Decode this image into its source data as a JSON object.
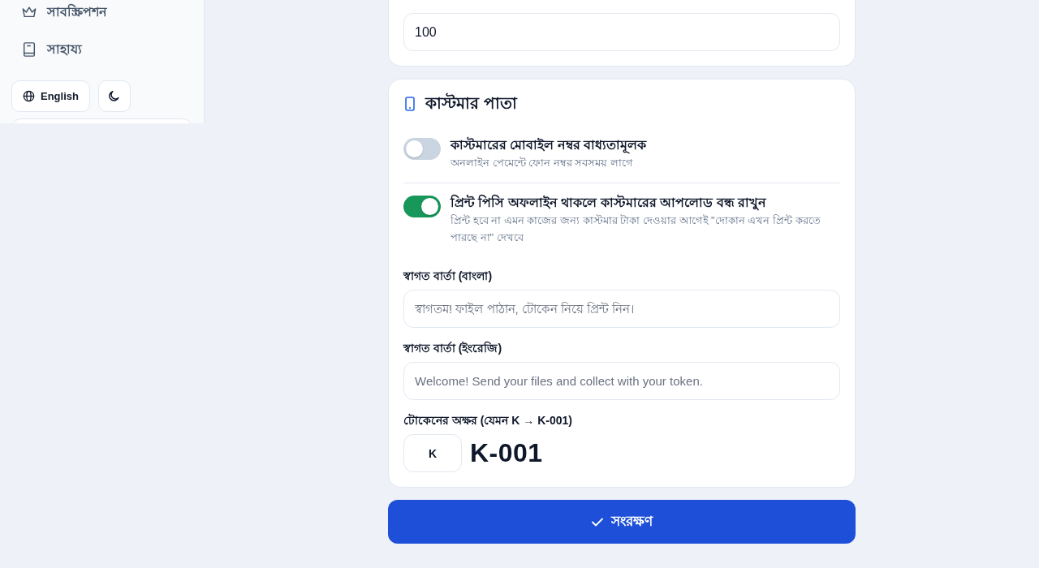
{
  "sidebar": {
    "items": [
      {
        "label": "সাবস্ক্রিপশন"
      },
      {
        "label": "সাহায্য"
      }
    ],
    "language_button": {
      "label": "English"
    }
  },
  "limits_card": {
    "input_value": "100"
  },
  "customer_page": {
    "title": "কাস্টমার পাতা",
    "toggles": [
      {
        "label": "কাস্টমারের মোবাইল নম্বর বাধ্যতামূলক",
        "description": "অনলাইন পেমেন্টে ফোন নম্বর সবসময় লাগে",
        "on": false
      },
      {
        "label": "প্রিন্ট পিসি অফলাইন থাকলে কাস্টমারের আপলোড বন্ধ রাখুন",
        "description": "প্রিন্ট হবে না এমন কাজের জন্য কাস্টমার টাকা দেওয়ার আগেই \"দোকান এখন প্রিন্ট করতে পারছে না\" দেখবে",
        "on": true
      }
    ],
    "fields": [
      {
        "label": "স্বাগত বার্তা (বাংলা)",
        "placeholder": "স্বাগতম! ফাইল পাঠান, টোকেন নিয়ে প্রিন্ট নিন।"
      },
      {
        "label": "স্বাগত বার্তা (ইংরেজি)",
        "placeholder": "Welcome! Send your files and collect with your token."
      }
    ],
    "token": {
      "label": "টোকেনের অক্ষর (যেমন K → K-001)",
      "value": "K",
      "preview": "K-001"
    }
  },
  "save_button": {
    "label": "সংরক্ষণ"
  }
}
